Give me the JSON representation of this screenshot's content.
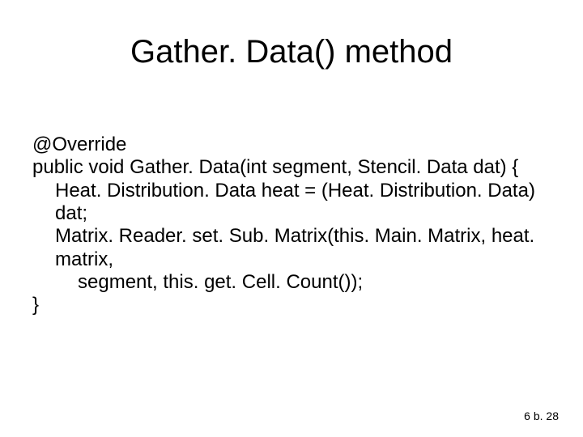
{
  "title": "Gather. Data() method",
  "code": {
    "l1": "@Override",
    "l2": "public void Gather. Data(int segment, Stencil. Data dat) {",
    "l3": "Heat. Distribution. Data heat = (Heat. Distribution. Data) dat;",
    "l4": "Matrix. Reader. set. Sub. Matrix(this. Main. Matrix, heat. matrix,",
    "l5": "segment, this. get. Cell. Count());",
    "l6": "}"
  },
  "page_number": "6 b. 28"
}
